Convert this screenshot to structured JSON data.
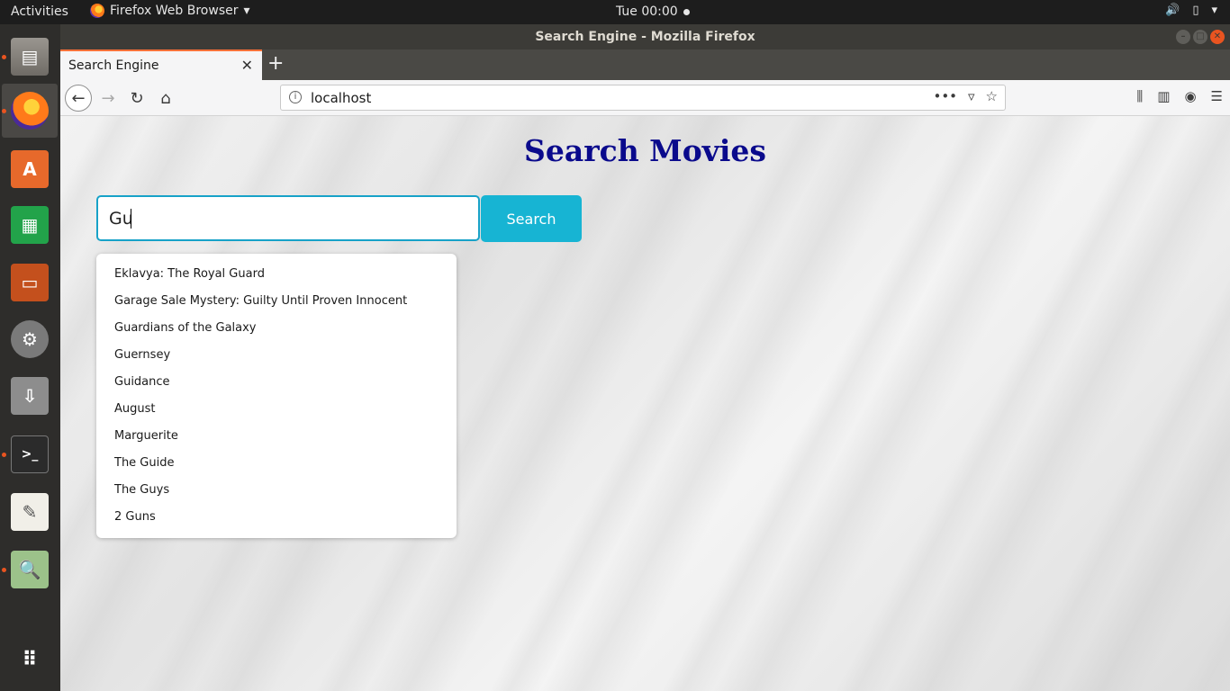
{
  "topbar": {
    "activities": "Activities",
    "app_name": "Firefox Web Browser",
    "clock": "Tue 00:00"
  },
  "window": {
    "title": "Search Engine - Mozilla Firefox"
  },
  "tab": {
    "title": "Search Engine"
  },
  "urlbar": {
    "url": "localhost"
  },
  "page": {
    "heading": "Search Movies",
    "search_value": "Gu",
    "search_button": "Search",
    "suggestions": [
      "Eklavya: The Royal Guard",
      "Garage Sale Mystery: Guilty Until Proven Innocent",
      "Guardians of the Galaxy",
      "Guernsey",
      "Guidance",
      "August",
      "Marguerite",
      "The Guide",
      "The Guys",
      "2 Guns"
    ]
  },
  "colors": {
    "heading": "#0a0a8c",
    "button": "#17b4d3",
    "accent": "#e95420"
  }
}
